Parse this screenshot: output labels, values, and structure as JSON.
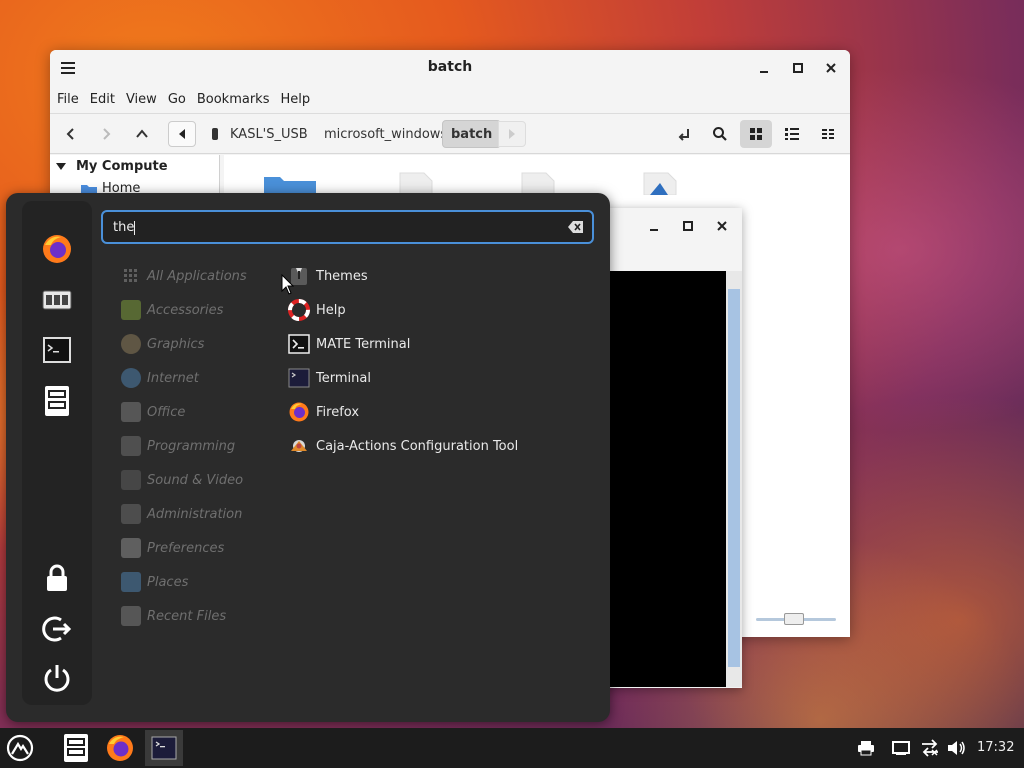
{
  "file_manager": {
    "title": "batch",
    "menu": [
      "File",
      "Edit",
      "View",
      "Go",
      "Bookmarks",
      "Help"
    ],
    "path": [
      "KASL'S_USB",
      "microsoft_windows",
      "batch"
    ],
    "sidebar": {
      "section": "My Compute",
      "items": [
        "Home"
      ]
    }
  },
  "app_menu": {
    "search": {
      "value": "the"
    },
    "categories": [
      "All Applications",
      "Accessories",
      "Graphics",
      "Internet",
      "Office",
      "Programming",
      "Sound & Video",
      "Administration",
      "Preferences",
      "Places",
      "Recent Files"
    ],
    "results": [
      "Themes",
      "Help",
      "MATE Terminal",
      "Terminal",
      "Firefox",
      "Caja-Actions Configuration Tool"
    ],
    "favorites": [
      "firefox-icon",
      "control-center-icon",
      "terminal-icon",
      "file-manager-icon"
    ],
    "session": [
      "lock-icon",
      "logout-icon",
      "power-icon"
    ]
  },
  "taskbar": {
    "clock": "17:32",
    "launchers": [
      "menu-icon",
      "file-manager-icon",
      "firefox-icon",
      "terminal-icon"
    ],
    "tray": [
      "printer-icon",
      "display-icon",
      "network-icon",
      "volume-icon"
    ]
  },
  "colors": {
    "accent": "#4a90d9",
    "menu_bg": "#2b2b2b",
    "taskbar_bg": "#1c1c1c"
  }
}
